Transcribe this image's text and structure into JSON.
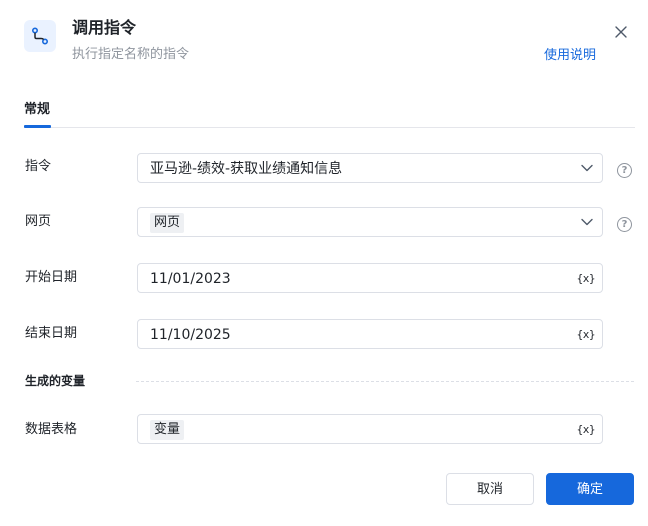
{
  "header": {
    "title": "调用指令",
    "subtitle": "执行指定名称的指令",
    "help_link": "使用说明",
    "icon": "flow-connector-icon"
  },
  "tabs": [
    {
      "label": "常规",
      "active": true
    }
  ],
  "form": {
    "command": {
      "label": "指令",
      "value": "亚马逊-绩效-获取业绩通知信息"
    },
    "webpage": {
      "label": "网页",
      "value": "网页"
    },
    "start_date": {
      "label": "开始日期",
      "value": "11/01/2023"
    },
    "end_date": {
      "label": "结束日期",
      "value": "11/10/2025"
    }
  },
  "variables_section": {
    "title": "生成的变量",
    "data_table": {
      "label": "数据表格",
      "value": "变量"
    }
  },
  "var_icon_text": "{x}",
  "help_icon_text": "?",
  "footer": {
    "cancel_label": "取消",
    "ok_label": "确定"
  },
  "colors": {
    "accent": "#1668dc",
    "icon_bg": "#eaf2ff",
    "border": "#dcdfe6",
    "muted_text": "#8f959e"
  }
}
